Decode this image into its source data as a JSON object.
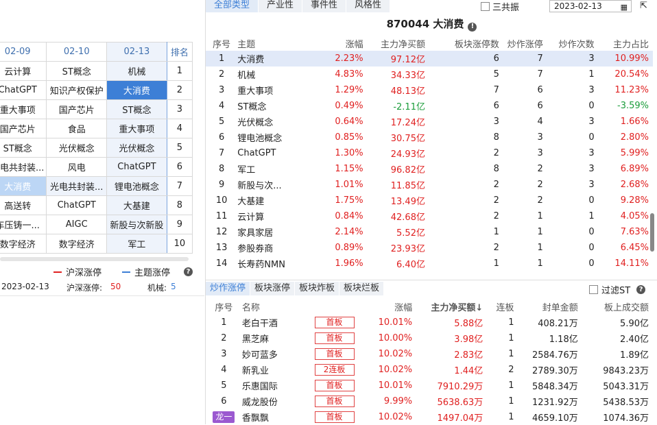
{
  "left_grid": {
    "headers": [
      "02-09",
      "02-10",
      "02-13",
      "排名"
    ],
    "rows": [
      [
        "云计算",
        "ST概念",
        "机械",
        "1"
      ],
      [
        "ChatGPT",
        "知识产权保护",
        "大消费",
        "2"
      ],
      [
        "重大事项",
        "国产芯片",
        "ST概念",
        "3"
      ],
      [
        "国产芯片",
        "食品",
        "重大事项",
        "4"
      ],
      [
        "ST概念",
        "光伏概念",
        "光伏概念",
        "5"
      ],
      [
        "光电共封装...",
        "风电",
        "ChatGPT",
        "6"
      ],
      [
        "大消费",
        "光电共封装...",
        "锂电池概念",
        "7"
      ],
      [
        "高送转",
        "ChatGPT",
        "大基建",
        "8"
      ],
      [
        "车压铸一...",
        "AIGC",
        "新股与次新股",
        "9"
      ],
      [
        "数字经济",
        "数字经济",
        "军工",
        "10"
      ]
    ]
  },
  "legend": {
    "item1": "沪深涨停",
    "item2": "主题涨停",
    "color1": "#e02020",
    "color2": "#3d7fd6"
  },
  "info": {
    "date": "2023-02-13",
    "label1": "沪深涨停:",
    "value1": "50",
    "label2": "机械:",
    "value2": "5"
  },
  "top_tabs": [
    "全部类型",
    "产业性",
    "事件性",
    "风格性"
  ],
  "sanjb_label": "三共振",
  "date_value": "2023-02-13",
  "title": "870044 大消费",
  "table1": {
    "headers": [
      "序号",
      "主题",
      "涨幅",
      "主力净买额",
      "板块涨停数",
      "炒作涨停",
      "炒作次数",
      "主力占比"
    ],
    "rows": [
      [
        "1",
        "大消费",
        "2.23%",
        "97.12亿",
        "6",
        "7",
        "3",
        "10.99%"
      ],
      [
        "2",
        "机械",
        "4.83%",
        "34.33亿",
        "5",
        "7",
        "1",
        "20.54%"
      ],
      [
        "3",
        "重大事项",
        "1.29%",
        "48.13亿",
        "7",
        "6",
        "3",
        "11.23%"
      ],
      [
        "4",
        "ST概念",
        "0.49%",
        "-2.11亿",
        "6",
        "6",
        "0",
        "-3.59%"
      ],
      [
        "5",
        "光伏概念",
        "0.64%",
        "17.24亿",
        "3",
        "4",
        "3",
        "1.66%"
      ],
      [
        "6",
        "锂电池概念",
        "0.85%",
        "30.75亿",
        "8",
        "3",
        "0",
        "2.80%"
      ],
      [
        "7",
        "ChatGPT",
        "1.30%",
        "24.93亿",
        "2",
        "3",
        "3",
        "5.99%"
      ],
      [
        "8",
        "军工",
        "1.15%",
        "96.82亿",
        "8",
        "2",
        "3",
        "6.89%"
      ],
      [
        "9",
        "新股与次...",
        "1.01%",
        "11.85亿",
        "2",
        "2",
        "3",
        "2.68%"
      ],
      [
        "10",
        "大基建",
        "1.75%",
        "13.49亿",
        "2",
        "2",
        "0",
        "9.28%"
      ],
      [
        "11",
        "云计算",
        "0.84%",
        "42.68亿",
        "2",
        "1",
        "1",
        "4.05%"
      ],
      [
        "12",
        "家具家居",
        "2.14%",
        "5.52亿",
        "1",
        "1",
        "0",
        "7.63%"
      ],
      [
        "13",
        "参股券商",
        "0.89%",
        "23.93亿",
        "2",
        "1",
        "0",
        "6.45%"
      ],
      [
        "14",
        "长寿药NMN",
        "1.96%",
        "6.40亿",
        "1",
        "1",
        "0",
        "14.11%"
      ]
    ]
  },
  "bottom_tabs": [
    "炒作涨停",
    "板块涨停",
    "板块炸板",
    "板块烂板"
  ],
  "filter_label": "过滤ST",
  "table2": {
    "headers": [
      "序号",
      "名称",
      "涨幅",
      "主力净买额↓",
      "连板",
      "封单金额",
      "板上成交额"
    ],
    "rows": [
      [
        "1",
        "老白干酒",
        "首板",
        "10.01%",
        "5.88亿",
        "1",
        "408.21万",
        "5.90亿"
      ],
      [
        "2",
        "黑芝麻",
        "首板",
        "10.00%",
        "3.98亿",
        "1",
        "1.18亿",
        "2.40亿"
      ],
      [
        "3",
        "妙可蓝多",
        "首板",
        "10.02%",
        "2.83亿",
        "1",
        "2584.76万",
        "1.89亿"
      ],
      [
        "4",
        "新乳业",
        "2连板",
        "10.02%",
        "1.44亿",
        "2",
        "2789.30万",
        "9843.23万"
      ],
      [
        "5",
        "乐惠国际",
        "首板",
        "10.01%",
        "7910.29万",
        "1",
        "5848.34万",
        "5043.31万"
      ],
      [
        "6",
        "威龙股份",
        "首板",
        "9.99%",
        "5638.63万",
        "1",
        "1231.92万",
        "5438.53万"
      ],
      [
        "龙一",
        "香飘飘",
        "首板",
        "10.02%",
        "1497.04万",
        "1",
        "4659.10万",
        "1074.36万"
      ]
    ]
  }
}
